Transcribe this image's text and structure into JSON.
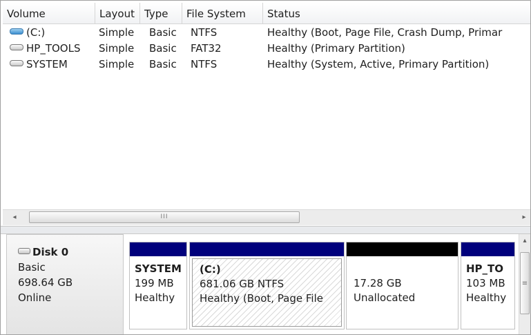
{
  "columns": [
    "Volume",
    "Layout",
    "Type",
    "File System",
    "Status"
  ],
  "volumes": [
    {
      "icon": "volume-icon-blue",
      "name": "(C:)",
      "layout": "Simple",
      "type": "Basic",
      "fs": "NTFS",
      "status": "Healthy (Boot, Page File, Crash Dump, Primar"
    },
    {
      "icon": "volume-icon-gray",
      "name": "HP_TOOLS",
      "layout": "Simple",
      "type": "Basic",
      "fs": "FAT32",
      "status": "Healthy (Primary Partition)"
    },
    {
      "icon": "volume-icon-gray",
      "name": "SYSTEM",
      "layout": "Simple",
      "type": "Basic",
      "fs": "NTFS",
      "status": "Healthy (System, Active, Primary Partition)"
    }
  ],
  "scrollbar": {
    "left_arrow": "◂",
    "right_arrow": "▸",
    "grip": "III",
    "up_arrow": "▴",
    "grip_v": "≡"
  },
  "disk": {
    "name": "Disk 0",
    "type": "Basic",
    "size": "698.64 GB",
    "status": "Online"
  },
  "partitions": [
    {
      "name": "SYSTEM",
      "size": "199 MB",
      "status": "Healthy",
      "bar_color": "#00007c"
    },
    {
      "name": "(C:)",
      "size": "681.06 GB NTFS",
      "status": "Healthy (Boot, Page File",
      "bar_color": "#00007c"
    },
    {
      "name": "",
      "size": "17.28 GB",
      "status": "Unallocated",
      "bar_color": "#000000"
    },
    {
      "name": "HP_TO",
      "size": "103 MB",
      "status": "Healthy",
      "bar_color": "#00007c"
    }
  ]
}
